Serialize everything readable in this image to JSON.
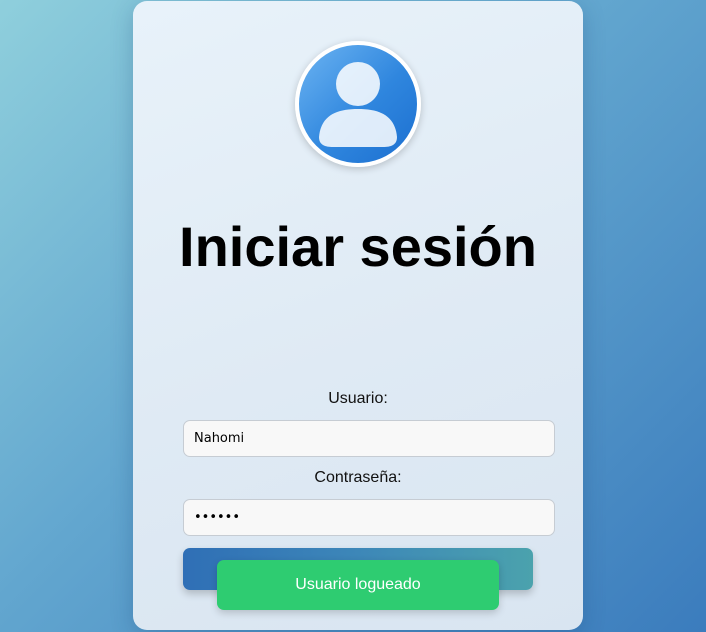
{
  "login": {
    "title": "Iniciar sesión",
    "username_label": "Usuario:",
    "username_value": "Nahomi",
    "password_label": "Contraseña:",
    "password_value": "••••••",
    "avatar_icon": "user-avatar-icon"
  },
  "notification": {
    "message": "Usuario logueado"
  },
  "colors": {
    "avatar": "#2f86de",
    "toast": "#2ecc71",
    "button_start": "#2f6fb6",
    "button_end": "#4ba2ad"
  }
}
